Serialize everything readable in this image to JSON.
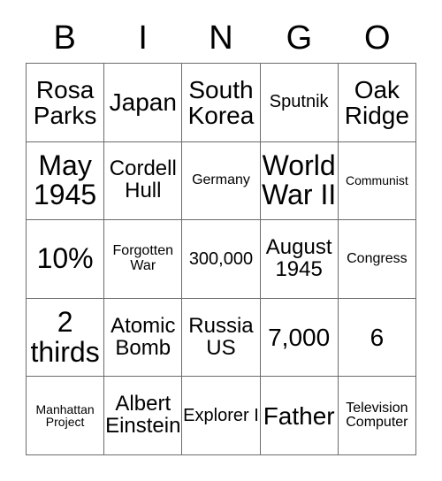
{
  "card": {
    "headers": [
      "B",
      "I",
      "N",
      "G",
      "O"
    ],
    "rows": [
      [
        {
          "text": "Rosa Parks",
          "size": "lg"
        },
        {
          "text": "Japan",
          "size": "lg"
        },
        {
          "text": "South Korea",
          "size": "lg"
        },
        {
          "text": "Sputnik",
          "size": "sm"
        },
        {
          "text": "Oak Ridge",
          "size": "lg"
        }
      ],
      [
        {
          "text": "May 1945",
          "size": "xl"
        },
        {
          "text": "Cordell Hull",
          "size": "md"
        },
        {
          "text": "Germany",
          "size": "xs"
        },
        {
          "text": "World War II",
          "size": "xl"
        },
        {
          "text": "Communist",
          "size": "xxs"
        }
      ],
      [
        {
          "text": "10%",
          "size": "xl"
        },
        {
          "text": "Forgotten War",
          "size": "xs"
        },
        {
          "text": "300,000",
          "size": "sm"
        },
        {
          "text": "August 1945",
          "size": "md"
        },
        {
          "text": "Congress",
          "size": "xs"
        }
      ],
      [
        {
          "text": "2 thirds",
          "size": "xl"
        },
        {
          "text": "Atomic Bomb",
          "size": "md"
        },
        {
          "text": "Russia US",
          "size": "md"
        },
        {
          "text": "7,000",
          "size": "lg"
        },
        {
          "text": "6",
          "size": "lg"
        }
      ],
      [
        {
          "text": "Manhattan Project",
          "size": "xxs"
        },
        {
          "text": "Albert Einstein",
          "size": "md"
        },
        {
          "text": "Explorer I",
          "size": "sm"
        },
        {
          "text": "Father",
          "size": "lg"
        },
        {
          "text": "Television Computer",
          "size": "xs"
        }
      ]
    ]
  },
  "colors": {
    "background": "#ffffff",
    "text": "#000000",
    "grid_line": "#6b6b6b"
  }
}
